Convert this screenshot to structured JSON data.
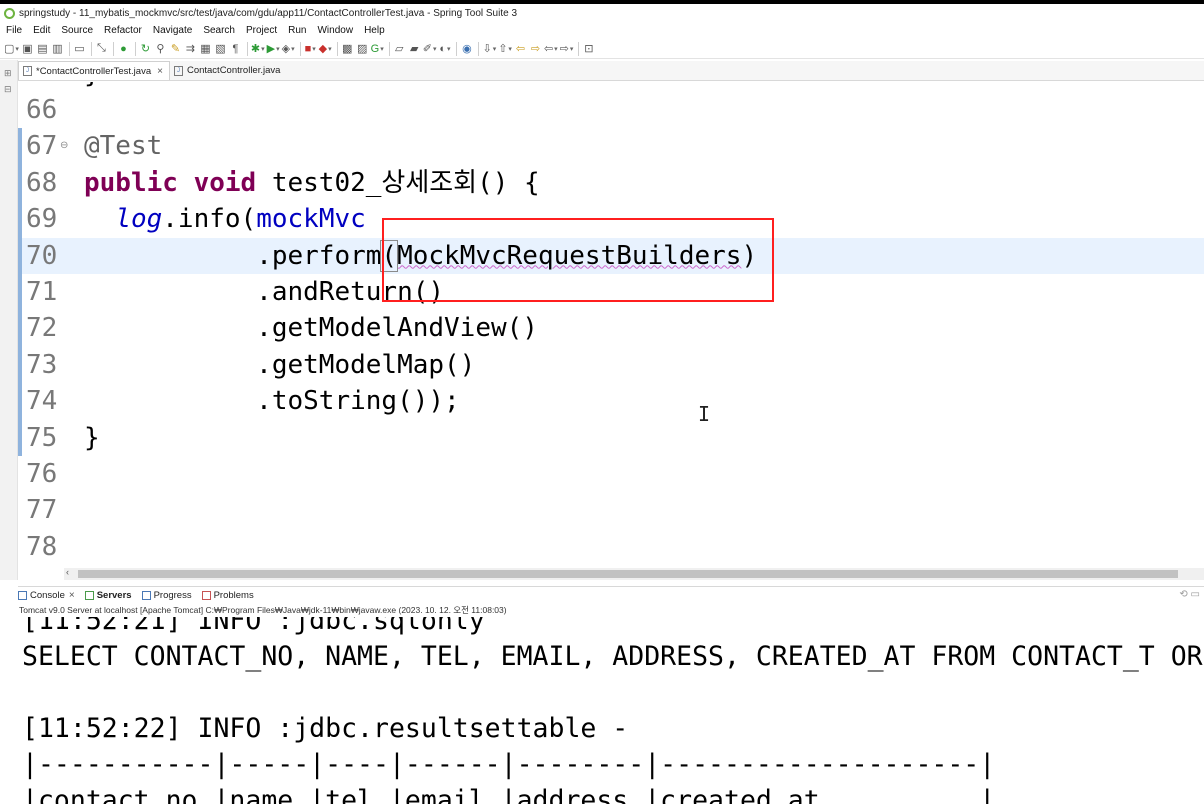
{
  "window": {
    "title": "springstudy - 11_mybatis_mockmvc/src/test/java/com/gdu/app11/ContactControllerTest.java - Spring Tool Suite 3"
  },
  "menu": [
    "File",
    "Edit",
    "Source",
    "Refactor",
    "Navigate",
    "Search",
    "Project",
    "Run",
    "Window",
    "Help"
  ],
  "tabs": [
    {
      "label": "*ContactControllerTest.java",
      "active": true,
      "close": "×"
    },
    {
      "label": "ContactController.java",
      "active": false
    }
  ],
  "editor": {
    "lines": [
      {
        "no": "66"
      },
      {
        "no": "67",
        "text": "@Test"
      },
      {
        "no": "68",
        "kw": "public void",
        "text": " test02_상세조회() {"
      },
      {
        "no": "69",
        "indent": "  ",
        "stat": "log",
        "mid": ".info(",
        "fld": "mockMvc"
      },
      {
        "no": "70",
        "indent": "           ",
        "pre": ".perform",
        "bracket": "(",
        "squig": "MockMvcRequestBuilders",
        "post": ")"
      },
      {
        "no": "71",
        "text": "           .andReturn()"
      },
      {
        "no": "72",
        "text": "           .getModelAndView()"
      },
      {
        "no": "73",
        "text": "           .getModelMap()"
      },
      {
        "no": "74",
        "text": "           .toString());"
      },
      {
        "no": "75",
        "text": "}"
      },
      {
        "no": "76"
      },
      {
        "no": "77"
      },
      {
        "no": "78"
      }
    ],
    "partial_top": "}"
  },
  "panel": {
    "tabs": [
      {
        "label": "Console",
        "close": "×"
      },
      {
        "label": "Servers"
      },
      {
        "label": "Progress"
      },
      {
        "label": "Problems"
      }
    ],
    "server_line": "Tomcat v9.0 Server at localhost [Apache Tomcat] C:₩Program Files₩Java₩jdk-11₩bin₩javaw.exe  (2023. 10. 12. 오전 11:08:03)",
    "console": [
      "[11:52:21] INFO :jdbc.sqlonly",
      "SELECT CONTACT_NO, NAME, TEL, EMAIL, ADDRESS, CREATED_AT FROM CONTACT_T ORDER BY",
      "",
      "[11:52:22] INFO :jdbc.resultsettable -",
      "|-----------|-----|----|------|--------|--------------------|",
      "|contact_no |name |tel |email |address |created_at          |"
    ]
  },
  "colors": {
    "keyword": "#7f0055",
    "field": "#0000c0",
    "annotation": "#646464",
    "current_line": "#e8f2fe",
    "highlight_box": "#ff1f1f"
  }
}
